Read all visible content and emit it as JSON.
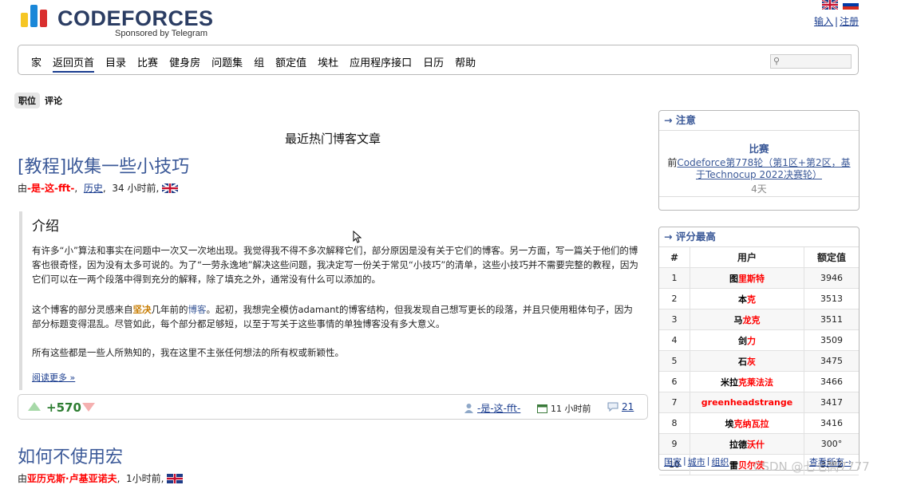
{
  "header": {
    "logo_text": "CODEFORCES",
    "logo_sub": "Sponsored by Telegram",
    "login": "输入",
    "register": "注册",
    "auth_sep": "|"
  },
  "menu": {
    "items": [
      "家",
      "返回页首",
      "目录",
      "比赛",
      "健身房",
      "问题集",
      "组",
      "额定值",
      "埃杜",
      "应用程序接口",
      "日历",
      "帮助"
    ],
    "active_index": 1
  },
  "subtabs": {
    "active": "职位",
    "other": "评论"
  },
  "main": {
    "section_title": "最近热门博客文章",
    "post1": {
      "title": "[教程]收集一些小技巧",
      "by": "由",
      "author": "-是-这-fft-",
      "comma": ",",
      "history": "历史",
      "time": "34 小时前,",
      "heading": "介绍",
      "p1": "有许多“小”算法和事实在问题中一次又一次地出现。我觉得我不得不多次解释它们，部分原因是没有关于它们的博客。另一方面，写一篇关于他们的博客也很奇怪，因为没有太多可说的。为了“一劳永逸地”解决这些问题，我决定写一份关于常见“小技巧”的清单，这些小技巧并不需要完整的教程，因为它们可以在一两个段落中得到充分的解释，除了填充之外，通常没有什么可以添加的。",
      "p2_a": "这个博客的部分灵感来自",
      "p2_hl": "坚决",
      "p2_b": "几年前的",
      "p2_link": "博客",
      "p2_c": "。起初，我想完全模仿adamant的博客结构，但我发现自己想写更长的段落，并且只使用粗体句子，因为部分标题变得混乱。尽管如此，每个部分都足够短，以至于写关于这些事情的单独博客没有多大意义。",
      "p3": "所有这些都是一些人所熟知的，我在这里不主张任何想法的所有权或新颖性。",
      "read_more": "阅读更多 »",
      "votes": "+570",
      "footer_user": "-是-这-fft-",
      "footer_time": "11 小时前",
      "comments": "21"
    },
    "post2": {
      "title": "如何不使用宏",
      "by": "由",
      "author": "亚历克斯·卢基亚诺夫",
      "comma": ",",
      "time": "1小时前,"
    }
  },
  "sidebar": {
    "attention": {
      "title": "→ 注意",
      "label": "比赛",
      "prefix": "前",
      "link": "Codeforce第778轮（第1区+第2区，基于Technocup 2022决赛轮）",
      "days": "4天"
    },
    "top_rated": {
      "title": "→ 评分最高",
      "headers": [
        "#",
        "用户",
        "额定值"
      ],
      "rows": [
        {
          "rank": "1",
          "first": "图",
          "rest": "里斯特",
          "rating": "3946"
        },
        {
          "rank": "2",
          "first": "本",
          "rest": "克",
          "rating": "3513"
        },
        {
          "rank": "3",
          "first": "马",
          "rest": "龙克",
          "rating": "3511"
        },
        {
          "rank": "4",
          "first": "剑",
          "rest": "力",
          "rating": "3509"
        },
        {
          "rank": "5",
          "first": "石",
          "rest": "灰",
          "rating": "3475"
        },
        {
          "rank": "6",
          "first": "米拉",
          "rest": "克莱法法",
          "rating": "3466"
        },
        {
          "rank": "7",
          "first": "",
          "rest": "greenheadstrange",
          "rating": "3417"
        },
        {
          "rank": "8",
          "first": "埃",
          "rest": "克纳瓦拉",
          "rating": "3416"
        },
        {
          "rank": "9",
          "first": "拉德",
          "rest": "沃什",
          "rating": "300°"
        },
        {
          "rank": "10",
          "first": "雷",
          "rest": "贝尔茨",
          "rating": "3382"
        }
      ],
      "footer_links": [
        "国家",
        "城市",
        "组织"
      ],
      "footer_sep": "|",
      "footer_right": "查看所有→"
    }
  },
  "watermark": "CSDN @七七高7777",
  "colors": {
    "accent": "#3b5998",
    "red": "#ff0000",
    "green": "#2e7d32"
  }
}
